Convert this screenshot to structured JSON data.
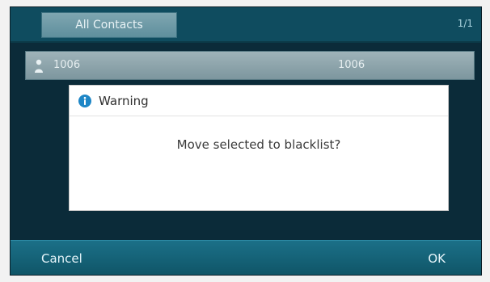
{
  "header": {
    "tab_label": "All Contacts",
    "right_indicator": "1/1"
  },
  "contact": {
    "name": "1006",
    "number": "1006"
  },
  "dialog": {
    "title": "Warning",
    "message": "Move selected to blacklist?"
  },
  "softkeys": {
    "cancel": "Cancel",
    "ok": "OK"
  },
  "colors": {
    "screen_bg": "#0b2b39",
    "topbar_bg": "#0f4c5f",
    "softkey_bg": "#0f5466",
    "dialog_bg": "#ffffff",
    "warning_icon": "#1e86c6"
  },
  "icons": {
    "contact": "contact-icon",
    "warning": "info-icon"
  }
}
